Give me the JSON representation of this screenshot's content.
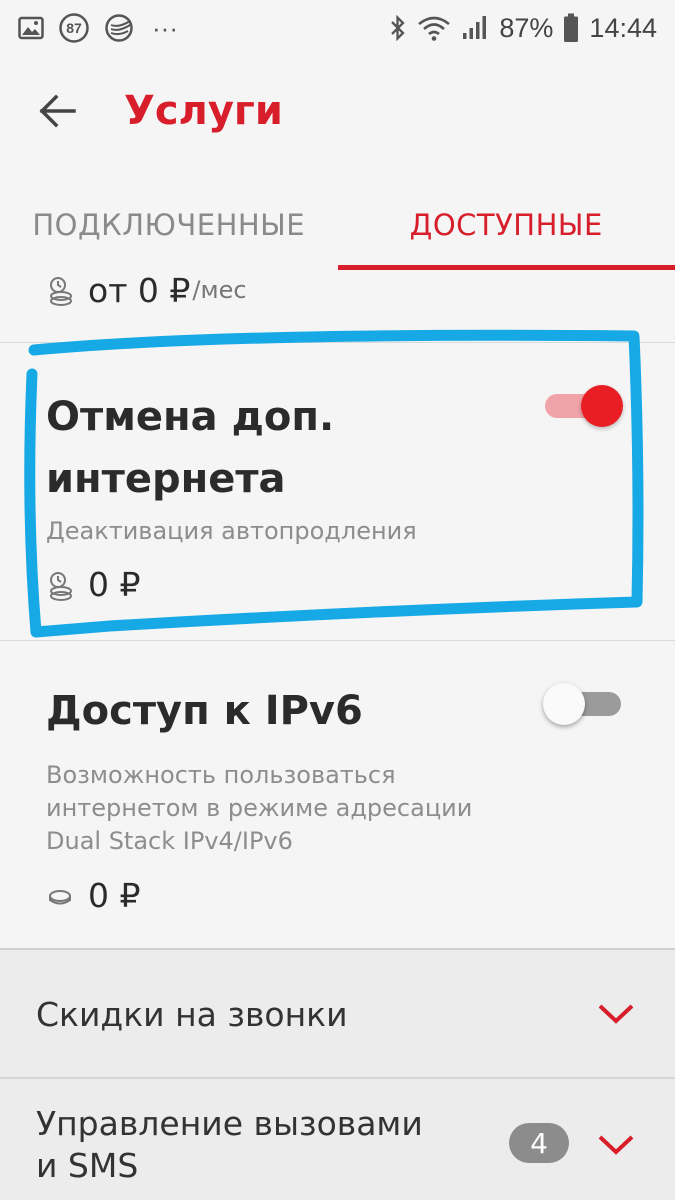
{
  "status_bar": {
    "notification_badge": "87",
    "more": "···",
    "battery": "87%",
    "time": "14:44",
    "icons": [
      "gallery-icon",
      "badge-icon",
      "sber-icon",
      "bluetooth-icon",
      "wifi-icon",
      "signal-icon",
      "battery-icon"
    ]
  },
  "header": {
    "title": "Услуги"
  },
  "tabs": [
    {
      "label": "ПОДКЛЮЧЕННЫЕ",
      "active": false
    },
    {
      "label": "ДОСТУПНЫЕ",
      "active": true
    }
  ],
  "partial_item": {
    "price": "от 0 ₽",
    "unit": "/мес"
  },
  "services": [
    {
      "title_line1": "Отмена доп.",
      "title_line2": "интернета",
      "description": "Деактивация автопродления",
      "price": "0 ₽",
      "enabled": true
    },
    {
      "title_line1": "Доступ к IPv6",
      "desc_line1": "Возможность пользоваться",
      "desc_line2": "интернетом в режиме адресации",
      "desc_line3": "Dual Stack IPv4/IPv6",
      "price": "0 ₽",
      "enabled": false
    }
  ],
  "sections": [
    {
      "label": "Скидки на звонки"
    },
    {
      "label_line1": "Управление вызовами",
      "label_line2": "и SMS",
      "count": "4"
    }
  ],
  "colors": {
    "accent": "#d81e2b",
    "toggle_on": "#e81e24",
    "highlight": "#17a9e6",
    "background": "#f5f5f5"
  }
}
